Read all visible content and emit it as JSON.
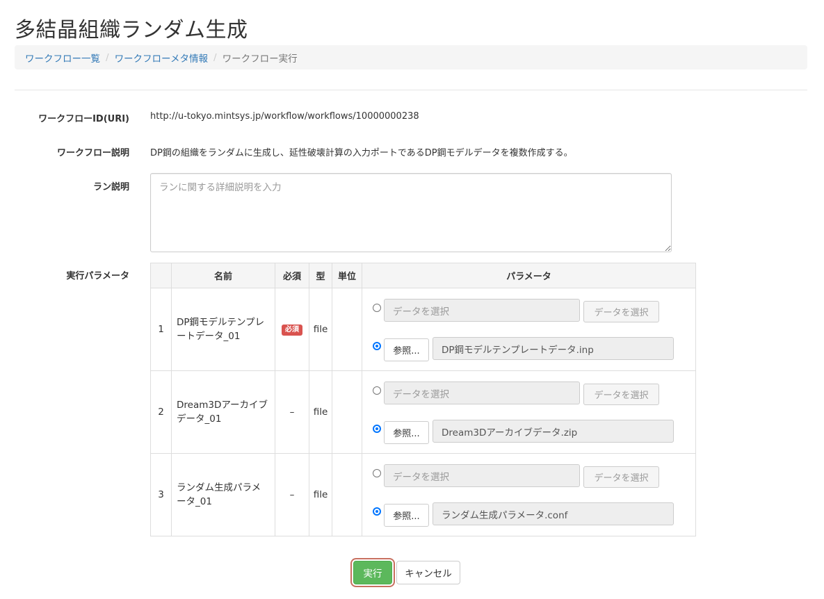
{
  "page": {
    "title": "多結晶組織ランダム生成"
  },
  "breadcrumb": {
    "items": [
      "ワークフロー一覧",
      "ワークフローメタ情報"
    ],
    "separator": "/",
    "current": "ワークフロー実行"
  },
  "form": {
    "workflow_id_label": "ワークフローID(URI)",
    "workflow_id_value": "http://u-tokyo.mintsys.jp/workflow/workflows/10000000238",
    "description_label": "ワークフロー説明",
    "description_value": "DP鋼の組織をランダムに生成し、延性破壊計算の入力ポートであるDP鋼モデルデータを複数作成する。",
    "run_desc_label": "ラン説明",
    "run_desc_placeholder": "ランに関する詳細説明を入力",
    "params_label": "実行パラメータ"
  },
  "params": {
    "headers": {
      "num": "",
      "name": "名前",
      "required": "必須",
      "type": "型",
      "unit": "単位",
      "param": "パラメータ"
    },
    "select_placeholder": "データを選択",
    "select_button": "データを選択",
    "browse_button": "参照...",
    "rows": [
      {
        "num": "1",
        "name": "DP鋼モデルテンプレートデータ_01",
        "required": "必須",
        "type": "file",
        "unit": "",
        "file": "DP鋼モデルテンプレートデータ.inp"
      },
      {
        "num": "2",
        "name": "Dream3Dアーカイブデータ_01",
        "required": "–",
        "type": "file",
        "unit": "",
        "file": "Dream3Dアーカイブデータ.zip"
      },
      {
        "num": "3",
        "name": "ランダム生成パラメータ_01",
        "required": "–",
        "type": "file",
        "unit": "",
        "file": "ランダム生成パラメータ.conf"
      }
    ]
  },
  "actions": {
    "run": "実行",
    "cancel": "キャンセル"
  },
  "colors": {
    "run_button": "#5cb85c",
    "required_badge": "#d9534f",
    "link": "#337ab7"
  }
}
